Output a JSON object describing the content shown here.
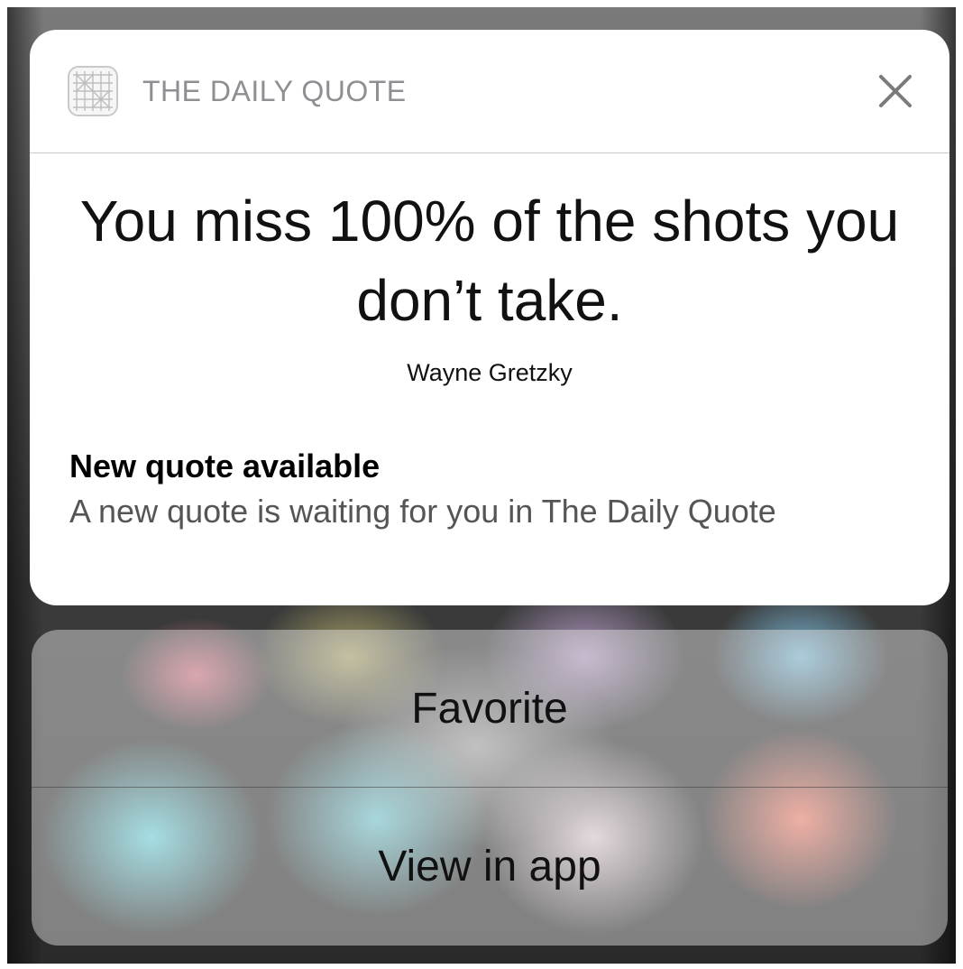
{
  "app": {
    "name": "THE DAILY QUOTE",
    "icon": "grid-app-icon"
  },
  "quote": {
    "text": "You miss 100% of the shots you don’t take.",
    "author": "Wayne Gretzky"
  },
  "notification": {
    "title": "New quote available",
    "body": "A new quote is waiting for you in The Daily Quote"
  },
  "actions": {
    "favorite_label": "Favorite",
    "view_label": "View in app"
  },
  "icons": {
    "close": "close-icon"
  },
  "colors": {
    "card_background": "#ffffff",
    "header_text": "#8e8e93",
    "body_text": "#555555"
  }
}
